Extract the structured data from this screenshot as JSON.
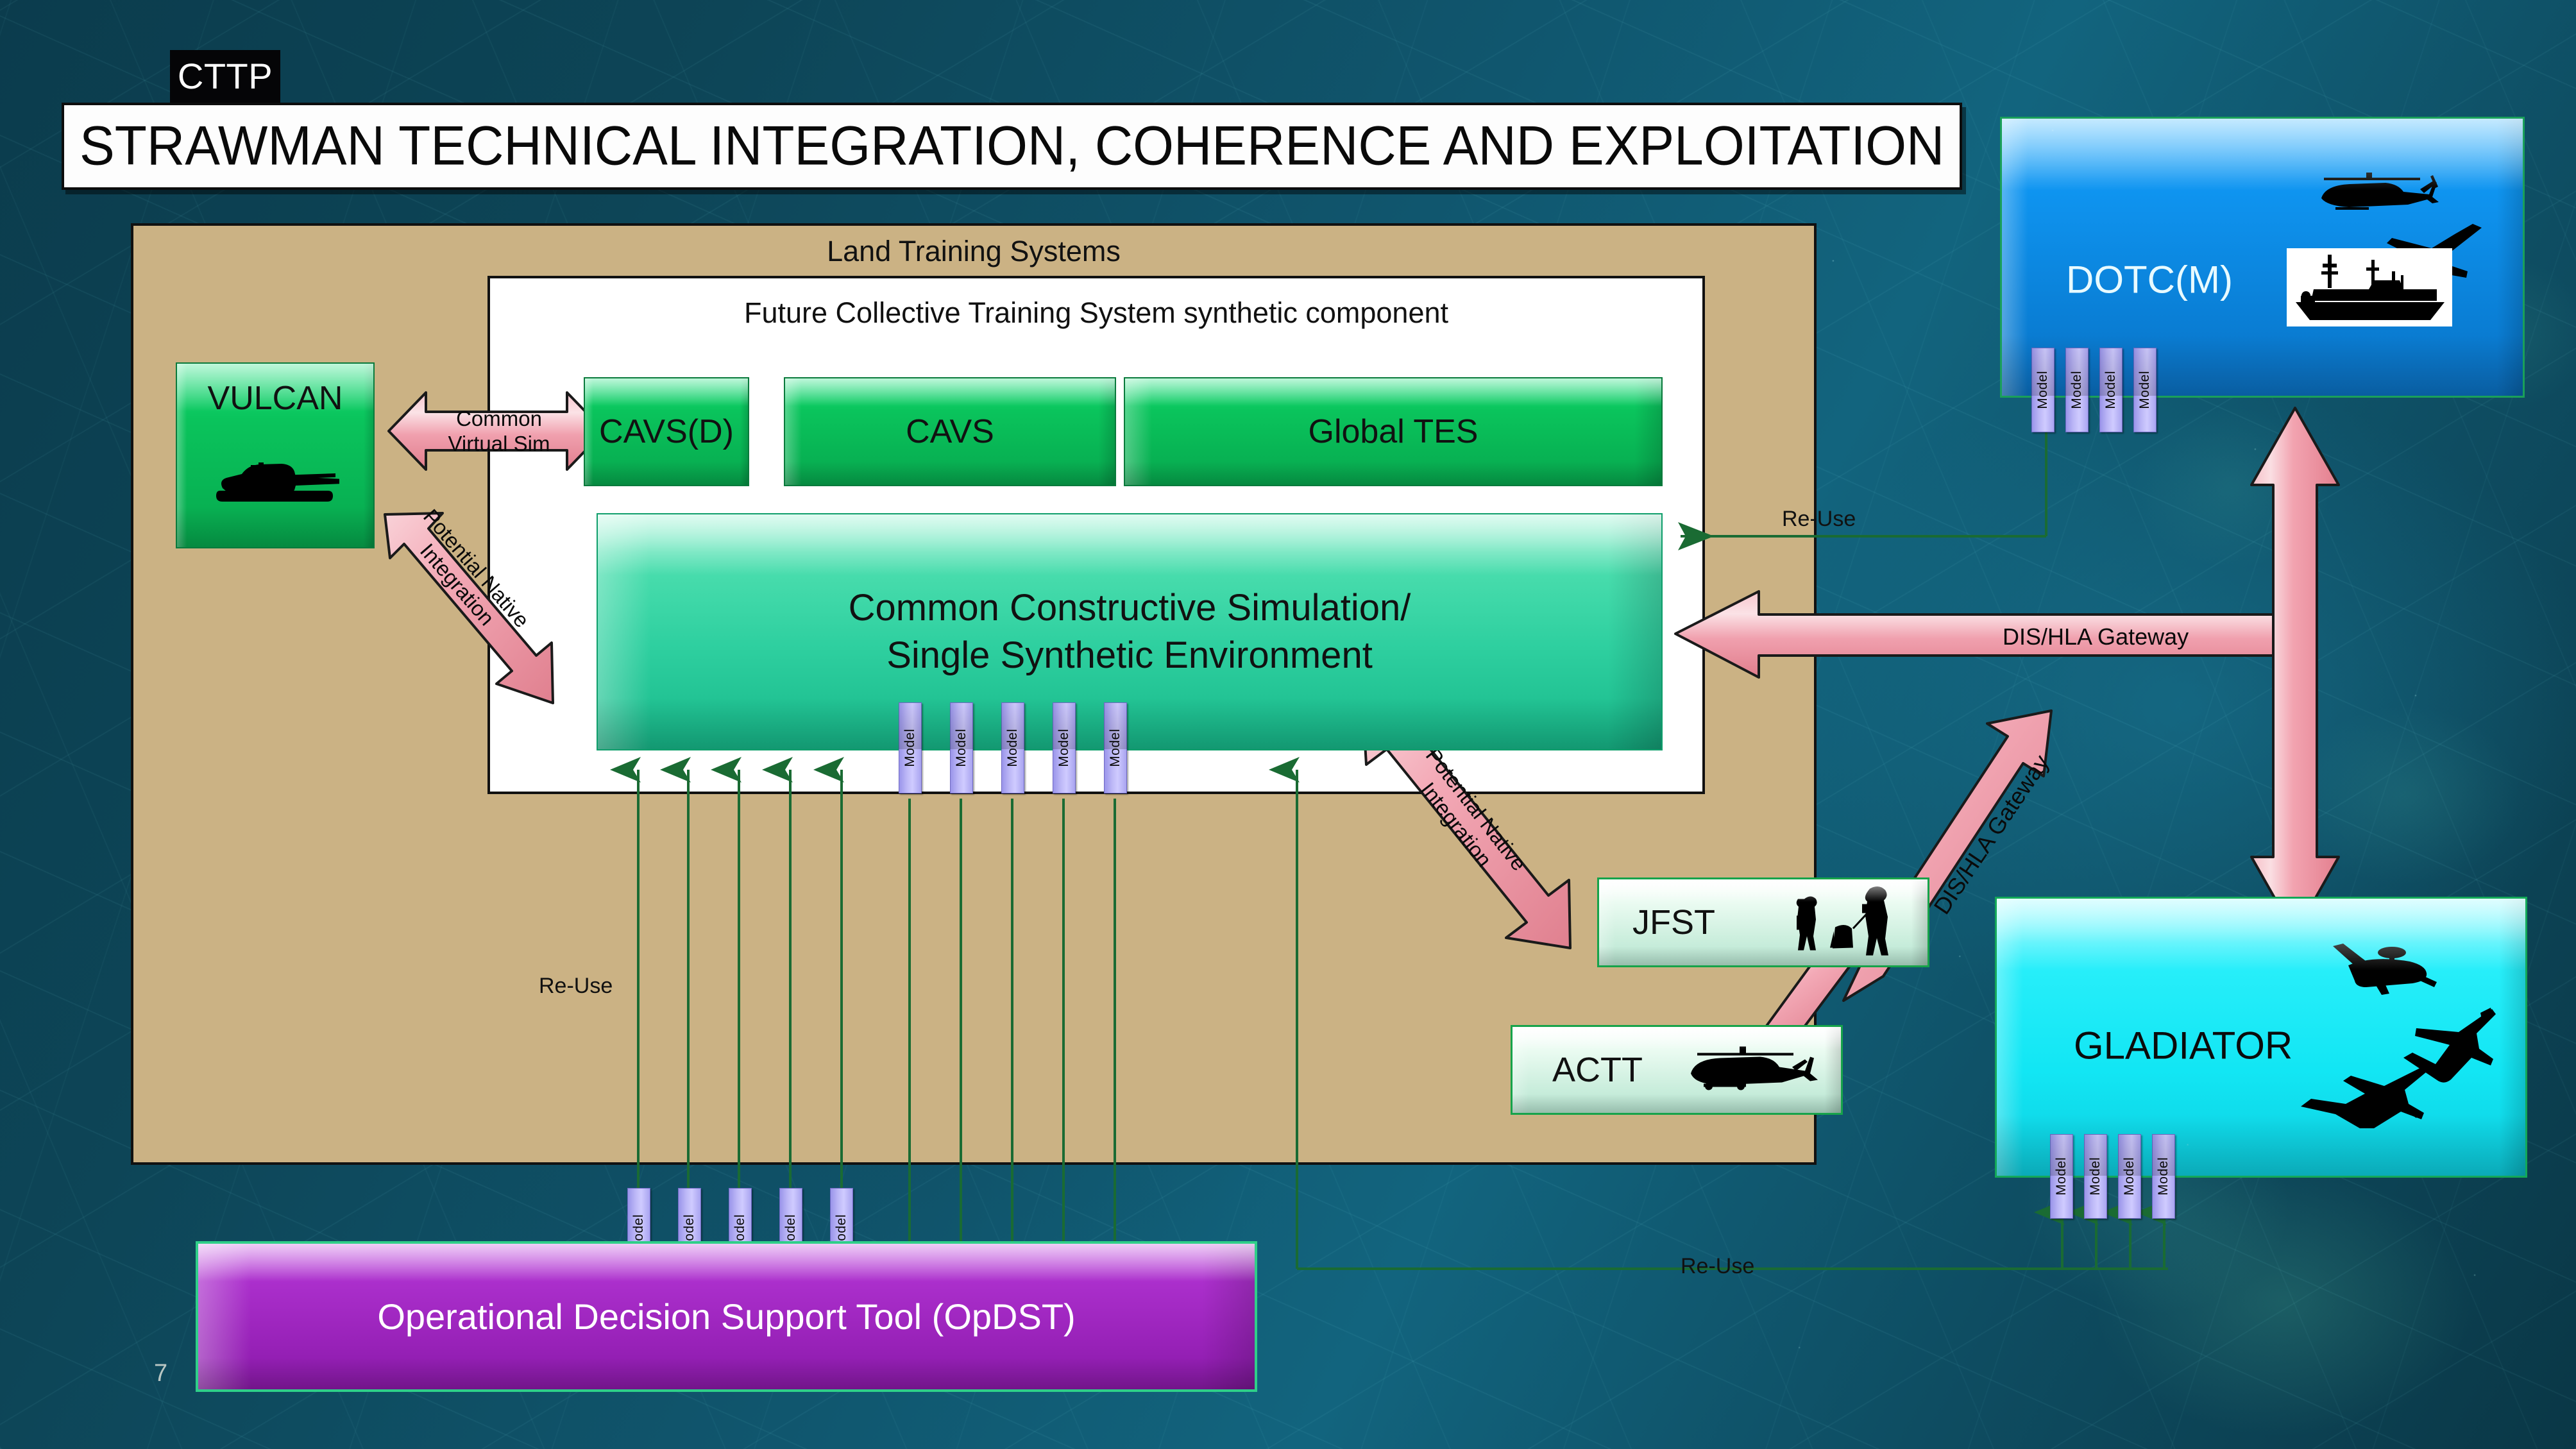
{
  "slide": {
    "tag": "CTTP",
    "title": "STRAWMAN TECHNICAL INTEGRATION, COHERENCE AND EXPLOITATION",
    "page_number": "7"
  },
  "colors": {
    "background_teal": "#0e4d62",
    "panel_tan": "#cbb284",
    "green_box": "#0ac45c",
    "teal_box": "#2fd9a0",
    "mint_box": "#d6f5e4",
    "blue_box": "#0c93ef",
    "cyan_box": "#14e9f5",
    "purple_box": "#a32cc4",
    "pink_arrow": "#f2a0ac",
    "model_tab": "#b5b0f2",
    "green_line": "#1a6b33"
  },
  "panels": {
    "land_training_systems": "Land Training Systems",
    "future_collective": "Future Collective Training System synthetic component"
  },
  "boxes": {
    "vulcan": "VULCAN",
    "cavsd": "CAVS(D)",
    "cavs": "CAVS",
    "global_tes": "Global TES",
    "ccs_line1": "Common Constructive Simulation/",
    "ccs_line2": "Single Synthetic Environment",
    "jfst": "JFST",
    "actt": "ACTT",
    "dotc": "DOTC(M)",
    "gladiator": "GLADIATOR",
    "opdst": "Operational Decision Support Tool (OpDST)"
  },
  "arrows": {
    "common_virtual_sim_l1": "Common",
    "common_virtual_sim_l2": "Virtual Sim",
    "potential_native_left_l1": "Potential Native",
    "potential_native_left_l2": "Integration",
    "potential_native_right_l1": "Potential Native",
    "potential_native_right_l2": "Integration",
    "dis_hla_horizontal": "DIS/HLA Gateway",
    "dis_hla_diagonal": "DIS/HLA Gateway"
  },
  "reuse_labels": {
    "top_right": "Re-Use",
    "left": "Re-Use",
    "bottom_right": "Re-Use"
  },
  "model_tab_label": "Model",
  "model_tab_groups": {
    "ccs": 5,
    "opdst": 5,
    "dotc": 4,
    "gladiator": 4
  },
  "icons": {
    "vulcan": "tank-icon",
    "jfst": "soldiers-icon",
    "actt": "attack-helicopter-icon",
    "dotc_air": "helicopter-icon",
    "dotc_jet": "fighter-jet-icon",
    "dotc_ship": "warship-icon",
    "gladiator_awacs": "awacs-aircraft-icon",
    "gladiator_typhoon": "typhoon-jet-icon",
    "gladiator_tornado": "tornado-jet-icon"
  }
}
